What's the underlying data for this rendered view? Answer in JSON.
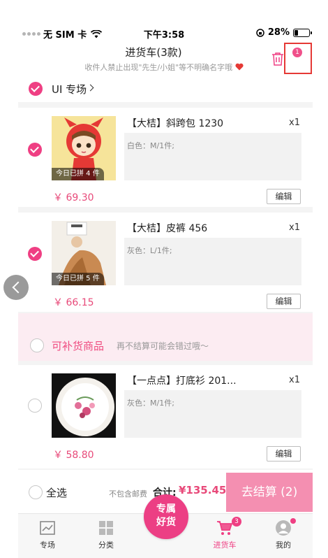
{
  "status_bar": {
    "carrier": "无 SIM 卡",
    "time": "下午3:58",
    "battery_percent": "28%",
    "battery_level": 0.28
  },
  "header": {
    "title": "进货车(3款)",
    "subtitle": "收件人禁止出现\"先生/小姐\"等不明确名字哦",
    "trash_icon": "trash-icon",
    "notification_count": "1"
  },
  "store": {
    "checked": true,
    "name": "UI 专场"
  },
  "items": [
    {
      "checked": true,
      "title": "【大桔】斜跨包 1230",
      "qty": "x1",
      "spec": "白色：M/1件;",
      "tag": "今日已拼 4 件",
      "price": "￥ 69.30",
      "edit_label": "编辑"
    },
    {
      "checked": true,
      "title": "【大桔】皮裤 456",
      "qty": "x1",
      "spec": "灰色：L/1件;",
      "tag": "今日已拼 5 件",
      "price": "￥ 66.15",
      "edit_label": "编辑"
    }
  ],
  "restock": {
    "checked": false,
    "title": "可补货商品",
    "hint": "再不结算可能会错过哦～",
    "item": {
      "checked": false,
      "title": "【一点点】打底衫 201...",
      "qty": "x1",
      "spec": "灰色：M/1件;",
      "price": "￥ 58.80",
      "edit_label": "编辑"
    }
  },
  "checkout": {
    "select_all_label": "全选",
    "shipping_note": "不包含邮费",
    "total_label": "合计:",
    "total_value": "¥135.45",
    "button_label": "去结算 (2)"
  },
  "tabbar": {
    "tabs": [
      {
        "label": "专场",
        "icon": "showcase-icon"
      },
      {
        "label": "分类",
        "icon": "grid-icon"
      },
      {
        "label": "进货车",
        "icon": "cart-icon",
        "badge": "3",
        "active": true
      },
      {
        "label": "我的",
        "icon": "user-icon"
      }
    ],
    "center_line1": "专属",
    "center_line2": "好货"
  },
  "colors": {
    "accent": "#ef3f83",
    "price": "#e84a7a",
    "checkout_button": "#f48fb1"
  }
}
